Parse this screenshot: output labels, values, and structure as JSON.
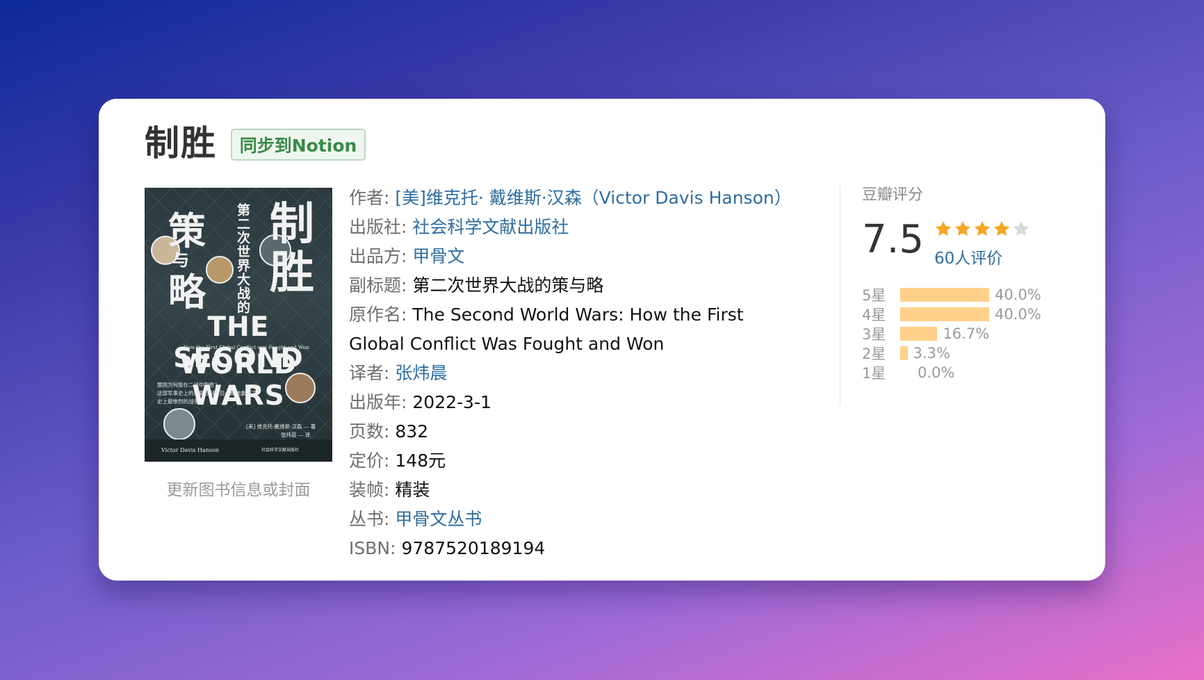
{
  "book": {
    "title": "制胜",
    "notion_button": "同步到Notion",
    "update_link": "更新图书信息或封面",
    "cover": {
      "title_big_1": "制",
      "title_big_2": "胜",
      "title_big_3": "策",
      "title_big_4": "略",
      "title_small_mid": "与",
      "subtitle_vertical": "第二次世界大战的",
      "en_line1": "THE SECOND",
      "en_line2": "WORLD WARS",
      "en_sub": "How the First Global Conflict was Fought and Won",
      "blurb1": "盟国为何能在二战中取胜?",
      "blurb2": "这部军事史上的鸿篇巨制耳目一新地重释了",
      "blurb3": "史上最惨烈的战争。",
      "credit_author": "[美] 维克托·戴维斯·汉森 — 著",
      "credit_translator": "张炜晨 — 译",
      "author_en": "Victor Davis Hanson",
      "publisher_small": "社会科学文献出版社"
    },
    "fields": {
      "author_label": "作者:",
      "author_value": "[美]维克托· 戴维斯·汉森（Victor Davis Hanson）",
      "publisher_label": "出版社:",
      "publisher_value": "社会科学文献出版社",
      "producer_label": "出品方:",
      "producer_value": "甲骨文",
      "subtitle_label": "副标题:",
      "subtitle_value": "第二次世界大战的策与略",
      "original_label": "原作名:",
      "original_value": "The Second World Wars: How the First Global Conflict Was Fought and Won",
      "translator_label": "译者:",
      "translator_value": "张炜晨",
      "pubyear_label": "出版年:",
      "pubyear_value": "2022-3-1",
      "pages_label": "页数:",
      "pages_value": "832",
      "price_label": "定价:",
      "price_value": "148元",
      "binding_label": "装帧:",
      "binding_value": "精装",
      "series_label": "丛书:",
      "series_value": "甲骨文丛书",
      "isbn_label": "ISBN:",
      "isbn_value": "9787520189194"
    }
  },
  "rating": {
    "heading": "豆瓣评分",
    "score": "7.5",
    "stars": 4,
    "stars_max": 5,
    "count_text": "60人评价",
    "distribution": [
      {
        "label": "5星",
        "percent_text": "40.0%",
        "percent": 40.0
      },
      {
        "label": "4星",
        "percent_text": "40.0%",
        "percent": 40.0
      },
      {
        "label": "3星",
        "percent_text": "16.7%",
        "percent": 16.7
      },
      {
        "label": "2星",
        "percent_text": "3.3%",
        "percent": 3.3
      },
      {
        "label": "1星",
        "percent_text": "0.0%",
        "percent": 0.0
      }
    ],
    "colors": {
      "bar": "#ffd08a",
      "star_on": "#f5a623",
      "star_off": "#d9d9d9"
    }
  }
}
